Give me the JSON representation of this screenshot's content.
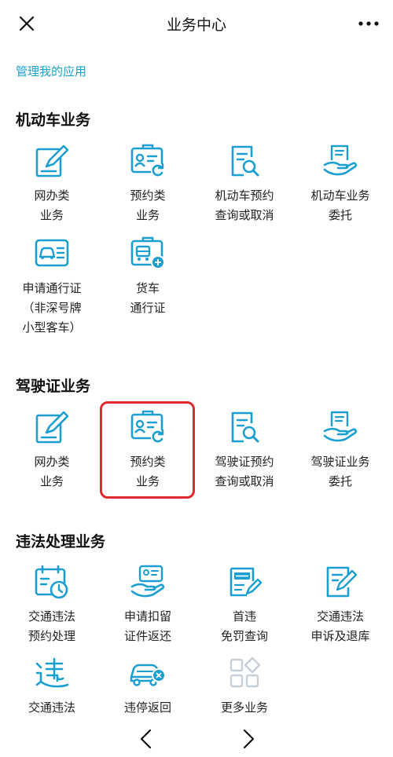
{
  "header": {
    "title": "业务中心",
    "close_icon": "close-icon",
    "more_icon": "more-dots-icon"
  },
  "manage_link": "管理我的应用",
  "colors": {
    "accent": "#1aa3c9",
    "icon": "#1a9fd0",
    "highlight": "#e0282e",
    "muted_icon": "#c8ced6"
  },
  "sections": [
    {
      "title": "机动车业务",
      "items": [
        {
          "label": "网办类\n业务",
          "icon": "edit-doc-icon"
        },
        {
          "label": "预约类\n业务",
          "icon": "id-card-refresh-icon"
        },
        {
          "label": "机动车预约\n查询或取消",
          "icon": "doc-search-icon"
        },
        {
          "label": "机动车业务\n委托",
          "icon": "hand-doc-icon"
        },
        {
          "label": "申请通行证\n（非深号牌\n小型客车）",
          "icon": "car-pass-icon"
        },
        {
          "label": "货车\n通行证",
          "icon": "truck-pass-icon"
        }
      ]
    },
    {
      "title": "驾驶证业务",
      "items": [
        {
          "label": "网办类\n业务",
          "icon": "edit-doc-icon"
        },
        {
          "label": "预约类\n业务",
          "icon": "id-card-refresh-icon"
        },
        {
          "label": "驾驶证预约\n查询或取消",
          "icon": "doc-search-icon"
        },
        {
          "label": "驾驶证业务\n委托",
          "icon": "hand-doc-icon"
        }
      ]
    },
    {
      "title": "违法处理业务",
      "items": [
        {
          "label": "交通违法\n预约处理",
          "icon": "calendar-clock-icon"
        },
        {
          "label": "申请扣留\n证件返还",
          "icon": "hand-card-icon"
        },
        {
          "label": "首违\n免罚查询",
          "icon": "free-fine-badge-icon"
        },
        {
          "label": "交通违法\n申诉及退库",
          "icon": "appeal-edit-icon"
        },
        {
          "label": "交通违法\n查询处理",
          "icon": "violation-char-icon"
        },
        {
          "label": "违停返回\n现场申报",
          "icon": "car-return-icon"
        },
        {
          "label": "更多业务",
          "icon": "more-apps-icon"
        }
      ]
    }
  ],
  "bottom_nav": {
    "back_icon": "chevron-left-icon",
    "forward_icon": "chevron-right-icon"
  }
}
